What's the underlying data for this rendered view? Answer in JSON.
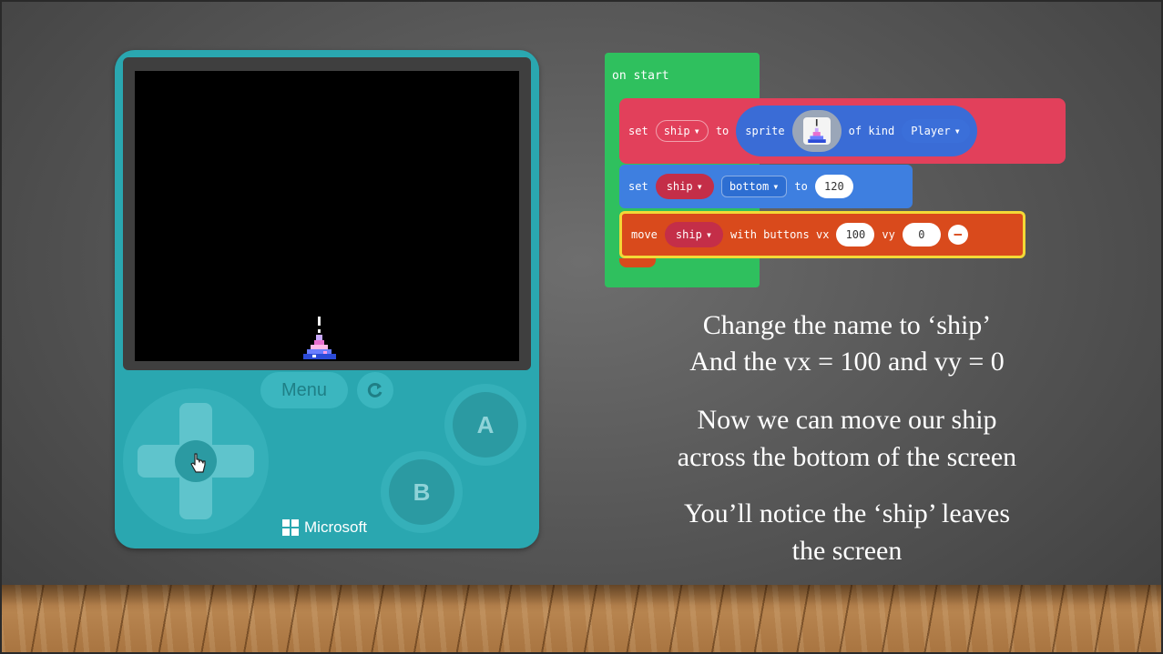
{
  "device": {
    "menu_label": "Menu",
    "a_label": "A",
    "b_label": "B",
    "brand": "Microsoft",
    "reset_icon": "refresh-icon",
    "cursor_icon": "hand-pointer-icon"
  },
  "blocks": {
    "on_start": "on start",
    "sprite_block": {
      "set": "set",
      "var": "ship",
      "to": "to",
      "sprite": "sprite",
      "of_kind": "of kind",
      "kind": "Player"
    },
    "set_block": {
      "set": "set",
      "var": "ship",
      "prop": "bottom",
      "to": "to",
      "value": "120"
    },
    "move_block": {
      "move": "move",
      "var": "ship",
      "with_buttons_vx": "with buttons vx",
      "vx": "100",
      "vy_label": "vy",
      "vy": "0"
    }
  },
  "caption": {
    "line1": "Change the name to ‘ship’",
    "line2": "And the vx = 100 and vy = 0",
    "line3": "Now we can move our ship",
    "line4": "across the bottom of the screen",
    "line5": "You’ll notice the ‘ship’ leaves",
    "line6": "the screen"
  },
  "colors": {
    "device": "#2aa7b0",
    "on_start": "#2fc05e",
    "sprite_block": "#e2405b",
    "set_block": "#3e7fe0",
    "move_block": "#d94a1c",
    "highlight": "#f3d936"
  }
}
